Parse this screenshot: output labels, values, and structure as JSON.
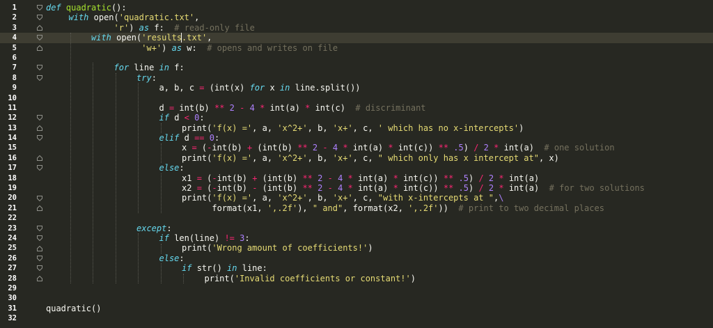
{
  "editor": {
    "highlighted_line": 4,
    "cursor": {
      "line": 4,
      "after_token_index": 5
    },
    "lines": [
      {
        "n": "1",
        "indent": 0,
        "fold": "open",
        "tokens": [
          [
            "def",
            "def "
          ],
          [
            "fn",
            "quadratic"
          ],
          [
            "tx",
            "():"
          ]
        ]
      },
      {
        "n": "2",
        "indent": 1,
        "fold": "open",
        "tokens": [
          [
            "kw",
            "with "
          ],
          [
            "tx",
            "open("
          ],
          [
            "str",
            "'quadratic.txt'"
          ],
          [
            "tx",
            ","
          ]
        ]
      },
      {
        "n": "3",
        "indent": 1,
        "fold": "close",
        "tokens": [
          [
            "tx",
            "         "
          ],
          [
            "str",
            "'r'"
          ],
          [
            "tx",
            ") "
          ],
          [
            "kw",
            "as "
          ],
          [
            "tx",
            "f:  "
          ],
          [
            "cm",
            "# read-only file"
          ]
        ]
      },
      {
        "n": "4",
        "indent": 2,
        "fold": "open",
        "tokens": [
          [
            "kw",
            "with "
          ],
          [
            "tx",
            "open("
          ],
          [
            "str",
            "'results"
          ],
          [
            "cursor",
            ""
          ],
          [
            "str",
            ".txt'"
          ],
          [
            "tx",
            ","
          ]
        ]
      },
      {
        "n": "5",
        "indent": 2,
        "fold": "close",
        "tokens": [
          [
            "tx",
            "          "
          ],
          [
            "str",
            "'w+'"
          ],
          [
            "tx",
            ") "
          ],
          [
            "kw",
            "as "
          ],
          [
            "tx",
            "w:  "
          ],
          [
            "cm",
            "# opens and writes on file"
          ]
        ]
      },
      {
        "n": "6",
        "indent": 0,
        "fold": "",
        "tokens": []
      },
      {
        "n": "7",
        "indent": 3,
        "fold": "open",
        "tokens": [
          [
            "kw",
            "for "
          ],
          [
            "tx",
            "line "
          ],
          [
            "kw",
            "in "
          ],
          [
            "tx",
            "f:"
          ]
        ]
      },
      {
        "n": "8",
        "indent": 4,
        "fold": "open",
        "tokens": [
          [
            "kw",
            "try"
          ],
          [
            "tx",
            ":"
          ]
        ]
      },
      {
        "n": "9",
        "indent": 5,
        "fold": "",
        "tokens": [
          [
            "tx",
            "a, b, c "
          ],
          [
            "op",
            "="
          ],
          [
            "tx",
            " (int(x) "
          ],
          [
            "kw",
            "for "
          ],
          [
            "tx",
            "x "
          ],
          [
            "kw",
            "in "
          ],
          [
            "tx",
            "line.split())"
          ]
        ]
      },
      {
        "n": "10",
        "indent": 0,
        "fold": "",
        "tokens": []
      },
      {
        "n": "11",
        "indent": 5,
        "fold": "",
        "tokens": [
          [
            "tx",
            "d "
          ],
          [
            "op",
            "="
          ],
          [
            "tx",
            " int(b) "
          ],
          [
            "op",
            "**"
          ],
          [
            "tx",
            " "
          ],
          [
            "num",
            "2"
          ],
          [
            "tx",
            " "
          ],
          [
            "op",
            "-"
          ],
          [
            "tx",
            " "
          ],
          [
            "num",
            "4"
          ],
          [
            "tx",
            " "
          ],
          [
            "op",
            "*"
          ],
          [
            "tx",
            " int(a) "
          ],
          [
            "op",
            "*"
          ],
          [
            "tx",
            " int(c)  "
          ],
          [
            "cm",
            "# discriminant"
          ]
        ]
      },
      {
        "n": "12",
        "indent": 5,
        "fold": "open",
        "tokens": [
          [
            "kw",
            "if "
          ],
          [
            "tx",
            "d "
          ],
          [
            "op",
            "<"
          ],
          [
            "tx",
            " "
          ],
          [
            "num",
            "0"
          ],
          [
            "tx",
            ":"
          ]
        ]
      },
      {
        "n": "13",
        "indent": 6,
        "fold": "close",
        "tokens": [
          [
            "tx",
            "print("
          ],
          [
            "str",
            "'f(x) ='"
          ],
          [
            "tx",
            ", a, "
          ],
          [
            "str",
            "'x^2+'"
          ],
          [
            "tx",
            ", b, "
          ],
          [
            "str",
            "'x+'"
          ],
          [
            "tx",
            ", c, "
          ],
          [
            "str",
            "' which has no x-intercepts'"
          ],
          [
            "tx",
            ")"
          ]
        ]
      },
      {
        "n": "14",
        "indent": 5,
        "fold": "open",
        "tokens": [
          [
            "kw",
            "elif "
          ],
          [
            "tx",
            "d "
          ],
          [
            "op",
            "=="
          ],
          [
            "tx",
            " "
          ],
          [
            "num",
            "0"
          ],
          [
            "tx",
            ":"
          ]
        ]
      },
      {
        "n": "15",
        "indent": 6,
        "fold": "",
        "tokens": [
          [
            "tx",
            "x "
          ],
          [
            "op",
            "="
          ],
          [
            "tx",
            " ("
          ],
          [
            "op",
            "-"
          ],
          [
            "tx",
            "int(b) "
          ],
          [
            "op",
            "+"
          ],
          [
            "tx",
            " (int(b) "
          ],
          [
            "op",
            "**"
          ],
          [
            "tx",
            " "
          ],
          [
            "num",
            "2"
          ],
          [
            "tx",
            " "
          ],
          [
            "op",
            "-"
          ],
          [
            "tx",
            " "
          ],
          [
            "num",
            "4"
          ],
          [
            "tx",
            " "
          ],
          [
            "op",
            "*"
          ],
          [
            "tx",
            " int(a) "
          ],
          [
            "op",
            "*"
          ],
          [
            "tx",
            " int(c)) "
          ],
          [
            "op",
            "**"
          ],
          [
            "tx",
            " "
          ],
          [
            "num",
            ".5"
          ],
          [
            "tx",
            ") "
          ],
          [
            "op",
            "/"
          ],
          [
            "tx",
            " "
          ],
          [
            "num",
            "2"
          ],
          [
            "tx",
            " "
          ],
          [
            "op",
            "*"
          ],
          [
            "tx",
            " int(a)  "
          ],
          [
            "cm",
            "# one solution"
          ]
        ]
      },
      {
        "n": "16",
        "indent": 6,
        "fold": "close",
        "tokens": [
          [
            "tx",
            "print("
          ],
          [
            "str",
            "'f(x) ='"
          ],
          [
            "tx",
            ", a, "
          ],
          [
            "str",
            "'x^2+'"
          ],
          [
            "tx",
            ", b, "
          ],
          [
            "str",
            "'x+'"
          ],
          [
            "tx",
            ", c, "
          ],
          [
            "str",
            "\" which only has x intercept at\""
          ],
          [
            "tx",
            ", x)"
          ]
        ]
      },
      {
        "n": "17",
        "indent": 5,
        "fold": "open",
        "tokens": [
          [
            "kw",
            "else"
          ],
          [
            "tx",
            ":"
          ]
        ]
      },
      {
        "n": "18",
        "indent": 6,
        "fold": "",
        "tokens": [
          [
            "tx",
            "x1 "
          ],
          [
            "op",
            "="
          ],
          [
            "tx",
            " ("
          ],
          [
            "op",
            "-"
          ],
          [
            "tx",
            "int(b) "
          ],
          [
            "op",
            "+"
          ],
          [
            "tx",
            " (int(b) "
          ],
          [
            "op",
            "**"
          ],
          [
            "tx",
            " "
          ],
          [
            "num",
            "2"
          ],
          [
            "tx",
            " "
          ],
          [
            "op",
            "-"
          ],
          [
            "tx",
            " "
          ],
          [
            "num",
            "4"
          ],
          [
            "tx",
            " "
          ],
          [
            "op",
            "*"
          ],
          [
            "tx",
            " int(a) "
          ],
          [
            "op",
            "*"
          ],
          [
            "tx",
            " int(c)) "
          ],
          [
            "op",
            "**"
          ],
          [
            "tx",
            " "
          ],
          [
            "num",
            ".5"
          ],
          [
            "tx",
            ") "
          ],
          [
            "op",
            "/"
          ],
          [
            "tx",
            " "
          ],
          [
            "num",
            "2"
          ],
          [
            "tx",
            " "
          ],
          [
            "op",
            "*"
          ],
          [
            "tx",
            " int(a)"
          ]
        ]
      },
      {
        "n": "19",
        "indent": 6,
        "fold": "",
        "tokens": [
          [
            "tx",
            "x2 "
          ],
          [
            "op",
            "="
          ],
          [
            "tx",
            " ("
          ],
          [
            "op",
            "-"
          ],
          [
            "tx",
            "int(b) "
          ],
          [
            "op",
            "-"
          ],
          [
            "tx",
            " (int(b) "
          ],
          [
            "op",
            "**"
          ],
          [
            "tx",
            " "
          ],
          [
            "num",
            "2"
          ],
          [
            "tx",
            " "
          ],
          [
            "op",
            "-"
          ],
          [
            "tx",
            " "
          ],
          [
            "num",
            "4"
          ],
          [
            "tx",
            " "
          ],
          [
            "op",
            "*"
          ],
          [
            "tx",
            " int(a) "
          ],
          [
            "op",
            "*"
          ],
          [
            "tx",
            " int(c)) "
          ],
          [
            "op",
            "**"
          ],
          [
            "tx",
            " "
          ],
          [
            "num",
            ".5"
          ],
          [
            "tx",
            ") "
          ],
          [
            "op",
            "/"
          ],
          [
            "tx",
            " "
          ],
          [
            "num",
            "2"
          ],
          [
            "tx",
            " "
          ],
          [
            "op",
            "*"
          ],
          [
            "tx",
            " int(a)  "
          ],
          [
            "cm",
            "# for two solutions"
          ]
        ]
      },
      {
        "n": "20",
        "indent": 6,
        "fold": "open",
        "tokens": [
          [
            "tx",
            "print("
          ],
          [
            "str",
            "'f(x) ='"
          ],
          [
            "tx",
            ", a, "
          ],
          [
            "str",
            "'x^2+'"
          ],
          [
            "tx",
            ", b, "
          ],
          [
            "str",
            "'x+'"
          ],
          [
            "tx",
            ", c, "
          ],
          [
            "str",
            "\"with x-intercepts at \""
          ],
          [
            "tx",
            ","
          ],
          [
            "esc",
            "\\"
          ]
        ]
      },
      {
        "n": "21",
        "indent": 6,
        "fold": "close",
        "tokens": [
          [
            "tx",
            "      format(x1, "
          ],
          [
            "str",
            "',.2f'"
          ],
          [
            "tx",
            "), "
          ],
          [
            "str",
            "\" and\""
          ],
          [
            "tx",
            ", format(x2, "
          ],
          [
            "str",
            "',.2f'"
          ],
          [
            "tx",
            "))  "
          ],
          [
            "cm",
            "# print to two decimal places"
          ]
        ]
      },
      {
        "n": "22",
        "indent": 0,
        "fold": "",
        "tokens": []
      },
      {
        "n": "23",
        "indent": 4,
        "fold": "open",
        "tokens": [
          [
            "kw",
            "except"
          ],
          [
            "tx",
            ":"
          ]
        ]
      },
      {
        "n": "24",
        "indent": 5,
        "fold": "open",
        "tokens": [
          [
            "kw",
            "if "
          ],
          [
            "tx",
            "len(line) "
          ],
          [
            "op",
            "!="
          ],
          [
            "tx",
            " "
          ],
          [
            "num",
            "3"
          ],
          [
            "tx",
            ":"
          ]
        ]
      },
      {
        "n": "25",
        "indent": 6,
        "fold": "close",
        "tokens": [
          [
            "tx",
            "print("
          ],
          [
            "str",
            "'Wrong amount of coefficients!'"
          ],
          [
            "tx",
            ")"
          ]
        ]
      },
      {
        "n": "26",
        "indent": 5,
        "fold": "open",
        "tokens": [
          [
            "kw",
            "else"
          ],
          [
            "tx",
            ":"
          ]
        ]
      },
      {
        "n": "27",
        "indent": 6,
        "fold": "open",
        "tokens": [
          [
            "kw",
            "if "
          ],
          [
            "tx",
            "str() "
          ],
          [
            "kw",
            "in "
          ],
          [
            "tx",
            "line:"
          ]
        ]
      },
      {
        "n": "28",
        "indent": 7,
        "fold": "close",
        "tokens": [
          [
            "tx",
            "print("
          ],
          [
            "str",
            "'Invalid coefficients or constant!'"
          ],
          [
            "tx",
            ")"
          ]
        ]
      },
      {
        "n": "29",
        "indent": 0,
        "fold": "",
        "tokens": []
      },
      {
        "n": "30",
        "indent": 0,
        "fold": "",
        "tokens": []
      },
      {
        "n": "31",
        "indent": 0,
        "fold": "",
        "tokens": [
          [
            "tx",
            "quadratic()"
          ]
        ]
      },
      {
        "n": "32",
        "indent": 0,
        "fold": "",
        "tokens": []
      }
    ]
  }
}
